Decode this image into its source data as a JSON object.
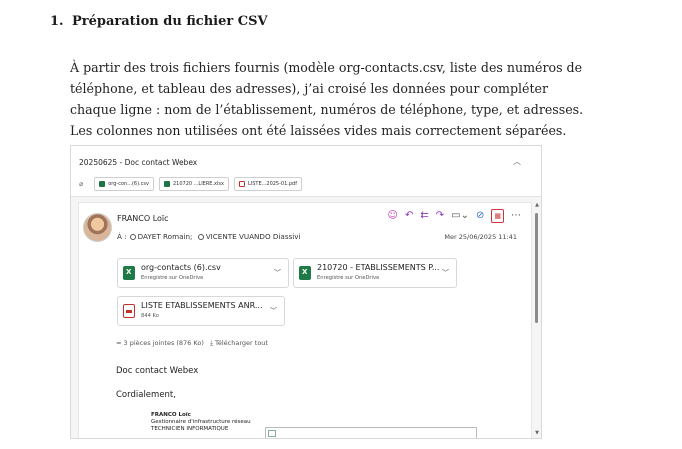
{
  "document": {
    "heading_number": "1.",
    "heading_text": "Préparation du fichier CSV",
    "paragraph": [
      "À partir des trois fichiers fournis (modèle org-contacts.csv, liste des numéros de",
      "téléphone, et tableau des adresses), j’ai croisé les données pour compléter",
      "chaque ligne : nom de l’établissement, numéros de téléphone, type, et adresses.",
      "Les colonnes non utilisées ont été laissées vides mais correctement séparées."
    ]
  },
  "email": {
    "subject": "20250625 - Doc contact Webex",
    "attachment_strip": [
      "org-con...(6).csv",
      "210720 ...LIERE.xlsx",
      "LISTE...2025-01.pdf"
    ],
    "sender": "FRANCO Loïc",
    "to_label": "À :",
    "recipients": [
      "DAYET Romain;",
      "VICENTE VUANDO Diassivi"
    ],
    "date": "Mer 25/06/2025 11:41",
    "attachments": [
      {
        "name": "org-contacts (6).csv",
        "sub": "Enregistré sur OneDrive",
        "type": "xls"
      },
      {
        "name": "210720 - ETABLISSEMENTS P...",
        "sub": "Enregistré sur OneDrive",
        "type": "xls"
      },
      {
        "name": "LISTE ETABLISSEMENTS ANR...",
        "sub": "844 Ko",
        "type": "pdf"
      }
    ],
    "summary": "3 pièces jointes (876 Ko)",
    "download_all": "Télécharger tout",
    "body_line1": "Doc contact Webex",
    "body_line2": "Cordialement,",
    "signature": {
      "name": "FRANCO Loïc",
      "role": "Gestionnaire d'infrastructure réseau",
      "title": "TECHNICIEN INFORMATIQUE"
    }
  },
  "icons": {
    "emoji": "smiley-icon",
    "reply": "reply-icon",
    "reply_all": "reply-all-icon",
    "forward": "forward-icon",
    "apps": "apps-icon",
    "link": "link-icon",
    "more": "more-icon",
    "clip": "paperclip-icon"
  }
}
